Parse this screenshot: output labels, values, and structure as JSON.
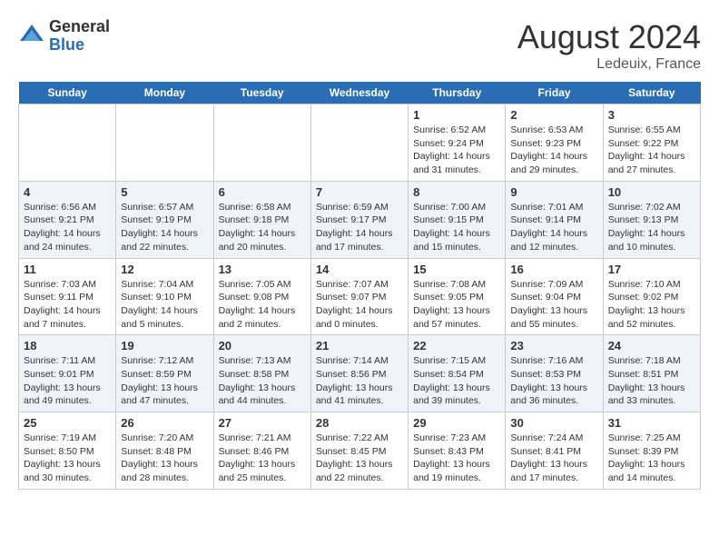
{
  "header": {
    "logo_general": "General",
    "logo_blue": "Blue",
    "month_year": "August 2024",
    "location": "Ledeuix, France"
  },
  "days_of_week": [
    "Sunday",
    "Monday",
    "Tuesday",
    "Wednesday",
    "Thursday",
    "Friday",
    "Saturday"
  ],
  "weeks": [
    [
      {
        "day": "",
        "info": ""
      },
      {
        "day": "",
        "info": ""
      },
      {
        "day": "",
        "info": ""
      },
      {
        "day": "",
        "info": ""
      },
      {
        "day": "1",
        "info": "Sunrise: 6:52 AM\nSunset: 9:24 PM\nDaylight: 14 hours\nand 31 minutes."
      },
      {
        "day": "2",
        "info": "Sunrise: 6:53 AM\nSunset: 9:23 PM\nDaylight: 14 hours\nand 29 minutes."
      },
      {
        "day": "3",
        "info": "Sunrise: 6:55 AM\nSunset: 9:22 PM\nDaylight: 14 hours\nand 27 minutes."
      }
    ],
    [
      {
        "day": "4",
        "info": "Sunrise: 6:56 AM\nSunset: 9:21 PM\nDaylight: 14 hours\nand 24 minutes."
      },
      {
        "day": "5",
        "info": "Sunrise: 6:57 AM\nSunset: 9:19 PM\nDaylight: 14 hours\nand 22 minutes."
      },
      {
        "day": "6",
        "info": "Sunrise: 6:58 AM\nSunset: 9:18 PM\nDaylight: 14 hours\nand 20 minutes."
      },
      {
        "day": "7",
        "info": "Sunrise: 6:59 AM\nSunset: 9:17 PM\nDaylight: 14 hours\nand 17 minutes."
      },
      {
        "day": "8",
        "info": "Sunrise: 7:00 AM\nSunset: 9:15 PM\nDaylight: 14 hours\nand 15 minutes."
      },
      {
        "day": "9",
        "info": "Sunrise: 7:01 AM\nSunset: 9:14 PM\nDaylight: 14 hours\nand 12 minutes."
      },
      {
        "day": "10",
        "info": "Sunrise: 7:02 AM\nSunset: 9:13 PM\nDaylight: 14 hours\nand 10 minutes."
      }
    ],
    [
      {
        "day": "11",
        "info": "Sunrise: 7:03 AM\nSunset: 9:11 PM\nDaylight: 14 hours\nand 7 minutes."
      },
      {
        "day": "12",
        "info": "Sunrise: 7:04 AM\nSunset: 9:10 PM\nDaylight: 14 hours\nand 5 minutes."
      },
      {
        "day": "13",
        "info": "Sunrise: 7:05 AM\nSunset: 9:08 PM\nDaylight: 14 hours\nand 2 minutes."
      },
      {
        "day": "14",
        "info": "Sunrise: 7:07 AM\nSunset: 9:07 PM\nDaylight: 14 hours\nand 0 minutes."
      },
      {
        "day": "15",
        "info": "Sunrise: 7:08 AM\nSunset: 9:05 PM\nDaylight: 13 hours\nand 57 minutes."
      },
      {
        "day": "16",
        "info": "Sunrise: 7:09 AM\nSunset: 9:04 PM\nDaylight: 13 hours\nand 55 minutes."
      },
      {
        "day": "17",
        "info": "Sunrise: 7:10 AM\nSunset: 9:02 PM\nDaylight: 13 hours\nand 52 minutes."
      }
    ],
    [
      {
        "day": "18",
        "info": "Sunrise: 7:11 AM\nSunset: 9:01 PM\nDaylight: 13 hours\nand 49 minutes."
      },
      {
        "day": "19",
        "info": "Sunrise: 7:12 AM\nSunset: 8:59 PM\nDaylight: 13 hours\nand 47 minutes."
      },
      {
        "day": "20",
        "info": "Sunrise: 7:13 AM\nSunset: 8:58 PM\nDaylight: 13 hours\nand 44 minutes."
      },
      {
        "day": "21",
        "info": "Sunrise: 7:14 AM\nSunset: 8:56 PM\nDaylight: 13 hours\nand 41 minutes."
      },
      {
        "day": "22",
        "info": "Sunrise: 7:15 AM\nSunset: 8:54 PM\nDaylight: 13 hours\nand 39 minutes."
      },
      {
        "day": "23",
        "info": "Sunrise: 7:16 AM\nSunset: 8:53 PM\nDaylight: 13 hours\nand 36 minutes."
      },
      {
        "day": "24",
        "info": "Sunrise: 7:18 AM\nSunset: 8:51 PM\nDaylight: 13 hours\nand 33 minutes."
      }
    ],
    [
      {
        "day": "25",
        "info": "Sunrise: 7:19 AM\nSunset: 8:50 PM\nDaylight: 13 hours\nand 30 minutes."
      },
      {
        "day": "26",
        "info": "Sunrise: 7:20 AM\nSunset: 8:48 PM\nDaylight: 13 hours\nand 28 minutes."
      },
      {
        "day": "27",
        "info": "Sunrise: 7:21 AM\nSunset: 8:46 PM\nDaylight: 13 hours\nand 25 minutes."
      },
      {
        "day": "28",
        "info": "Sunrise: 7:22 AM\nSunset: 8:45 PM\nDaylight: 13 hours\nand 22 minutes."
      },
      {
        "day": "29",
        "info": "Sunrise: 7:23 AM\nSunset: 8:43 PM\nDaylight: 13 hours\nand 19 minutes."
      },
      {
        "day": "30",
        "info": "Sunrise: 7:24 AM\nSunset: 8:41 PM\nDaylight: 13 hours\nand 17 minutes."
      },
      {
        "day": "31",
        "info": "Sunrise: 7:25 AM\nSunset: 8:39 PM\nDaylight: 13 hours\nand 14 minutes."
      }
    ]
  ]
}
